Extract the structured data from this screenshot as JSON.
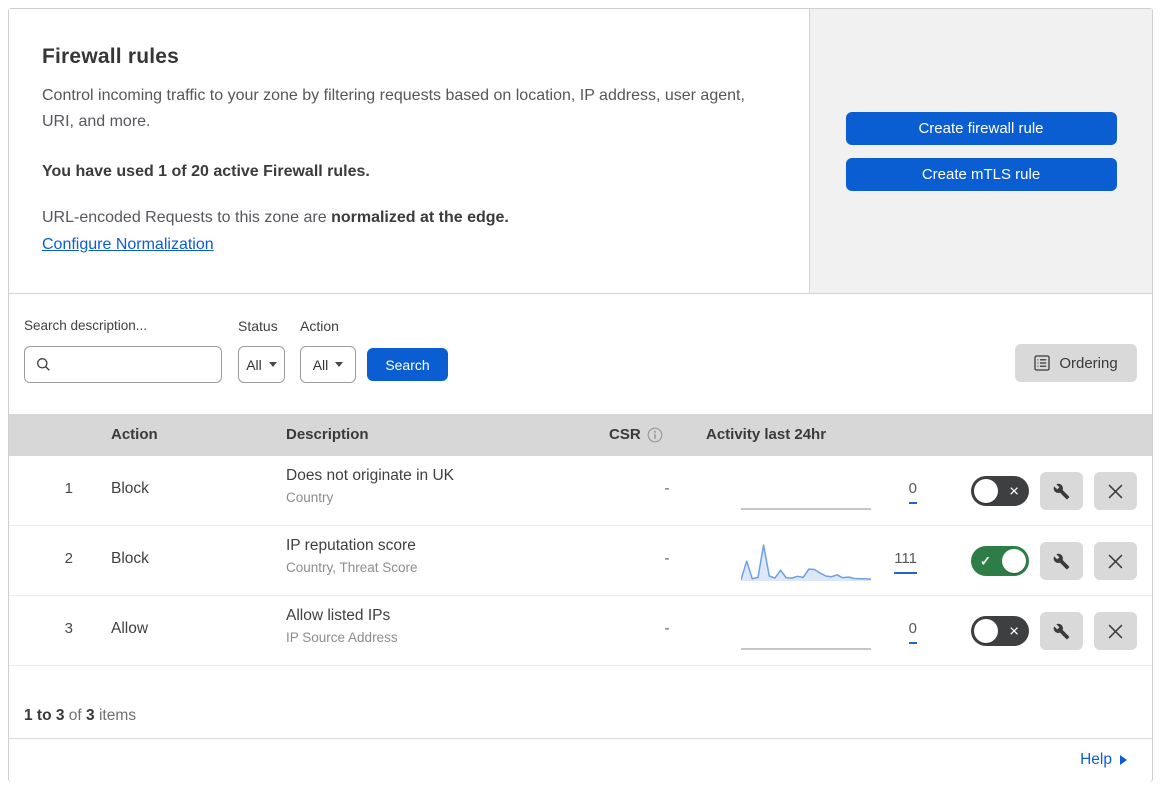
{
  "header": {
    "title": "Firewall rules",
    "description": "Control incoming traffic to your zone by filtering requests based on location, IP address, user agent, URI, and more.",
    "usage": "You have used 1 of 20 active Firewall rules.",
    "normalization_prefix": "URL-encoded Requests to this zone are ",
    "normalization_bold": "normalized at the edge.",
    "normalization_link": "Configure Normalization",
    "buttons": {
      "create_firewall": "Create firewall rule",
      "create_mtls": "Create mTLS rule"
    }
  },
  "filters": {
    "search_label": "Search description...",
    "search_value": "",
    "status_label": "Status",
    "status_value": "All",
    "action_label": "Action",
    "action_value": "All",
    "search_button": "Search",
    "ordering_button": "Ordering"
  },
  "table": {
    "headers": {
      "action": "Action",
      "description": "Description",
      "csr": "CSR",
      "activity": "Activity last 24hr"
    },
    "rows": [
      {
        "priority": "1",
        "action": "Block",
        "description": "Does not originate in UK",
        "criteria": "Country",
        "csr": "-",
        "activity_count": "0",
        "activity_sparkline": "flat-zero",
        "enabled": false
      },
      {
        "priority": "2",
        "action": "Block",
        "description": "IP reputation score",
        "criteria": "Country, Threat Score",
        "csr": "-",
        "activity_count": "111",
        "activity_sparkline": "line",
        "enabled": true
      },
      {
        "priority": "3",
        "action": "Allow",
        "description": "Allow listed IPs",
        "criteria": "IP Source Address",
        "csr": "-",
        "activity_count": "0",
        "activity_sparkline": "flat-zero",
        "enabled": false
      }
    ]
  },
  "footer": {
    "range": "1 to 3",
    "of": " of ",
    "total": "3",
    "items": " items",
    "help": "Help"
  },
  "icons": {
    "toggle_off_glyph": "×",
    "toggle_on_glyph": "✓"
  },
  "colors": {
    "accent_blue": "#0b5ed1",
    "link_blue": "#0b5ed1",
    "count_underline_blue": "#2465c8",
    "toggle_on_green": "#2c7d46",
    "toggle_off_gray": "#3d3f41",
    "table_header_bg": "#d7d7d7",
    "icon_button_bg": "#d9d9d9",
    "side_panel_bg": "#f1f1f2",
    "sparkline_line": "#6f9fe0",
    "sparkline_fill": "#dce8f8"
  },
  "chart_data": {
    "type": "line",
    "title": "Activity last 24hr sparkline (rule 2: IP reputation score)",
    "x": [
      0,
      1,
      2,
      3,
      4,
      5,
      6,
      7,
      8,
      9,
      10,
      11,
      12,
      13,
      14,
      15,
      16,
      17,
      18,
      19,
      20,
      21,
      22,
      23
    ],
    "values": [
      4,
      55,
      6,
      10,
      100,
      14,
      8,
      30,
      9,
      8,
      13,
      10,
      33,
      32,
      22,
      14,
      12,
      17,
      9,
      11,
      7,
      6,
      6,
      5
    ],
    "ylim": [
      0,
      100
    ],
    "xlabel": "",
    "ylabel": "",
    "grid": false,
    "legend": false,
    "note": "Unlabeled mini sparkline; values are relative request activity over last 24h. Total events shown: 111. Rules 1 and 3 show a flat zero line with total 0."
  }
}
